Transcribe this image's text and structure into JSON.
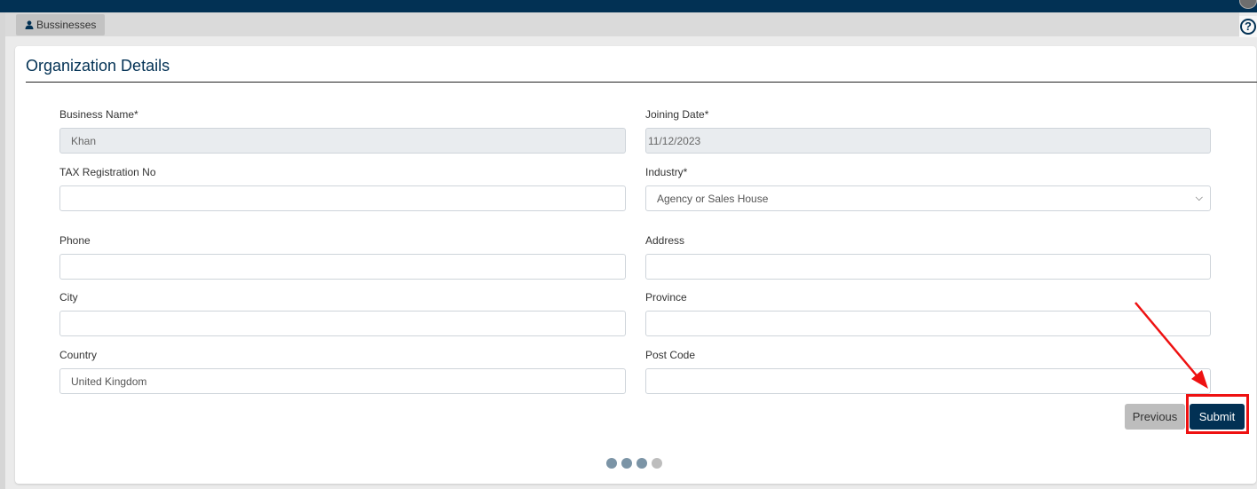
{
  "header": {
    "avatar": "user-avatar"
  },
  "tabs": [
    {
      "label": "Bussinesses",
      "icon": "user-icon"
    }
  ],
  "help": {
    "icon": "help-icon",
    "glyph": "?"
  },
  "form": {
    "title": "Organization Details",
    "fields": {
      "business_name": {
        "label": "Business Name*",
        "value": "Khan",
        "disabled": true
      },
      "joining_date": {
        "label": "Joining Date*",
        "value": "11/12/2023",
        "disabled": true
      },
      "tax_registration_no": {
        "label": "TAX Registration No",
        "value": ""
      },
      "industry": {
        "label": "Industry*",
        "value": "Agency or Sales House",
        "chevron": "⌄"
      },
      "phone": {
        "label": "Phone",
        "value": ""
      },
      "address": {
        "label": "Address",
        "value": ""
      },
      "city": {
        "label": "City",
        "value": ""
      },
      "province": {
        "label": "Province",
        "value": ""
      },
      "country": {
        "label": "Country",
        "value": "United Kingdom"
      },
      "post_code": {
        "label": "Post Code",
        "value": ""
      }
    },
    "buttons": {
      "previous": "Previous",
      "submit": "Submit"
    }
  },
  "stepper": {
    "total_steps": 4,
    "current_step": 3
  },
  "annotation": {
    "color": "#ee1111",
    "target": "submit-button"
  }
}
